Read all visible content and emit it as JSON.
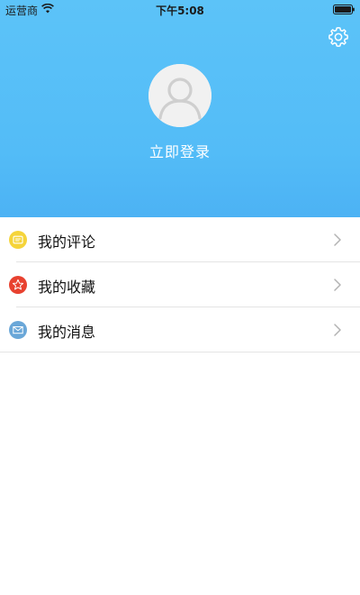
{
  "status_bar": {
    "carrier": "运营商",
    "time": "下午5:08",
    "wifi_icon": "wifi-icon",
    "battery_icon": "battery-icon"
  },
  "header": {
    "settings_icon": "gear-icon",
    "avatar_icon": "user-avatar-placeholder",
    "login_label": "立即登录",
    "background_color": "#56bef7"
  },
  "menu": {
    "items": [
      {
        "label": "我的评论",
        "icon": "comment-icon",
        "icon_color": "#f5d43a"
      },
      {
        "label": "我的收藏",
        "icon": "star-icon",
        "icon_color": "#e8412f"
      },
      {
        "label": "我的消息",
        "icon": "envelope-icon",
        "icon_color": "#6aa7d8"
      }
    ],
    "chevron_icon": "chevron-right-icon"
  }
}
